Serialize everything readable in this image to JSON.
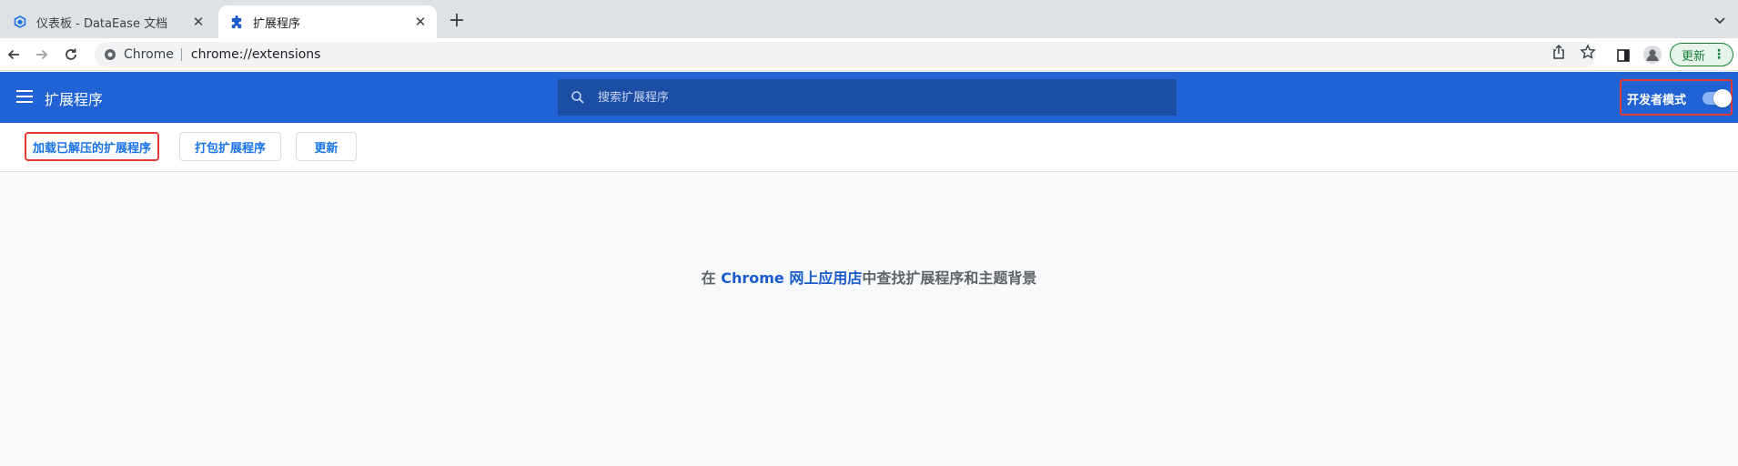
{
  "tabs": [
    {
      "title": "仪表板 - DataEase 文档",
      "active": false,
      "icon": "dataease-favicon"
    },
    {
      "title": "扩展程序",
      "active": true,
      "icon": "puzzle-piece-icon"
    }
  ],
  "omnibox": {
    "chip": "Chrome",
    "url": "chrome://extensions"
  },
  "update_button": "更新",
  "header": {
    "title": "扩展程序",
    "search_placeholder": "搜索扩展程序",
    "dev_mode_label": "开发者模式",
    "dev_mode_on": true
  },
  "actions": {
    "load_unpacked": "加载已解压的扩展程序",
    "pack": "打包扩展程序",
    "update": "更新"
  },
  "empty_state": {
    "prefix": "在 ",
    "link": "Chrome 网上应用店",
    "suffix": "中查找扩展程序和主题背景"
  },
  "colors": {
    "header_bg": "#2163d4",
    "accent": "#1a73e8",
    "highlight": "#e53935",
    "update_green": "#188038"
  }
}
